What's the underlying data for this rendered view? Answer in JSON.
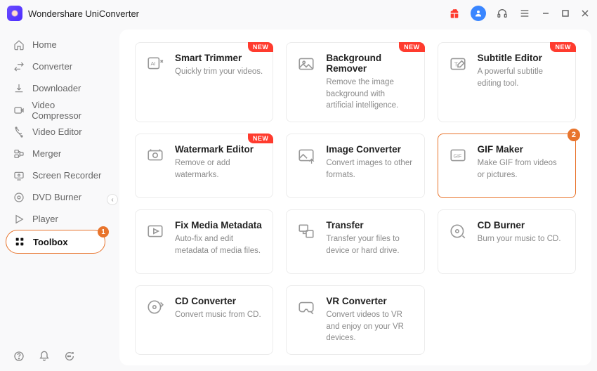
{
  "app_title": "Wondershare UniConverter",
  "sidebar": {
    "items": [
      {
        "label": "Home"
      },
      {
        "label": "Converter"
      },
      {
        "label": "Downloader"
      },
      {
        "label": "Video Compressor"
      },
      {
        "label": "Video Editor"
      },
      {
        "label": "Merger"
      },
      {
        "label": "Screen Recorder"
      },
      {
        "label": "DVD Burner"
      },
      {
        "label": "Player"
      },
      {
        "label": "Toolbox",
        "active": true,
        "badge": "1"
      }
    ],
    "collapse_glyph": "‹"
  },
  "tools": [
    {
      "title": "Smart Trimmer",
      "desc": "Quickly trim your videos.",
      "new": true
    },
    {
      "title": "Background Remover",
      "desc": "Remove the image background with artificial intelligence.",
      "new": true
    },
    {
      "title": "Subtitle Editor",
      "desc": "A powerful subtitle editing tool.",
      "new": true
    },
    {
      "title": "Watermark Editor",
      "desc": "Remove or add watermarks.",
      "new": true
    },
    {
      "title": "Image Converter",
      "desc": "Convert images to other formats."
    },
    {
      "title": "GIF Maker",
      "desc": "Make GIF from videos or pictures.",
      "highlight": true,
      "badge": "2"
    },
    {
      "title": "Fix Media Metadata",
      "desc": "Auto-fix and edit metadata of media files."
    },
    {
      "title": "Transfer",
      "desc": "Transfer your files to device or hard drive."
    },
    {
      "title": "CD Burner",
      "desc": "Burn your music to CD."
    },
    {
      "title": "CD Converter",
      "desc": "Convert music from CD."
    },
    {
      "title": "VR Converter",
      "desc": "Convert videos to VR and enjoy on your VR devices."
    }
  ],
  "labels": {
    "new": "NEW"
  }
}
